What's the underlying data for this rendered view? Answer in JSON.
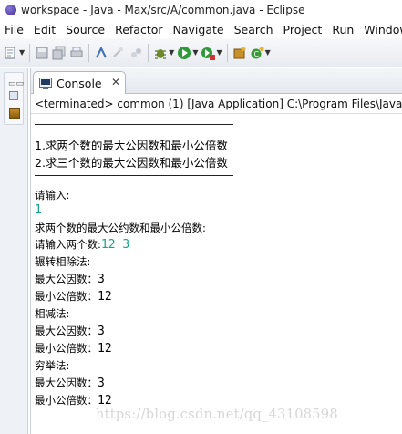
{
  "window": {
    "title": "workspace - Java - Max/src/A/common.java - Eclipse"
  },
  "menu": [
    "File",
    "Edit",
    "Source",
    "Refactor",
    "Navigate",
    "Search",
    "Project",
    "Run",
    "Window"
  ],
  "console": {
    "tab_label": "Console",
    "status": "<terminated> common (1) [Java Application] C:\\Program Files\\Java\\jre",
    "menu_options": [
      "1.求两个数的最大公因数和最小公倍数",
      "2.求三个数的最大公因数和最小公倍数"
    ],
    "prompt_input": "请输入:",
    "input_choice": "1",
    "section_heading": "求两个数的最大公约数和最小公倍数:",
    "prompt_two_numbers": "请输入两个数:",
    "input_numbers": "12 3",
    "method1": "辗转相除法:",
    "method1_gcd_label": "最大公因数：",
    "method1_gcd_value": "3",
    "method1_lcm_label": "最小公倍数：",
    "method1_lcm_value": "12",
    "method2": "相减法:",
    "method2_gcd_label": "最大公因数：",
    "method2_gcd_value": "3",
    "method2_lcm_label": "最小公倍数：",
    "method2_lcm_value": "12",
    "method3": "穷举法:",
    "method3_gcd_label": "最大公因数：",
    "method3_gcd_value": "3",
    "method3_lcm_label": "最小公倍数：",
    "method3_lcm_value": "12"
  },
  "watermark": "https://blog.csdn.net/qq_43108598",
  "icons": [
    "new-icon",
    "save-icon",
    "save-all-icon",
    "print-icon",
    "open-type-icon",
    "search-icon",
    "toggle-mark-icon",
    "debug-icon",
    "run-icon",
    "external-tools-icon",
    "new-java-package-icon",
    "new-java-class-icon",
    "minimize-icon",
    "restore-icon",
    "package-explorer-icon",
    "console-icon",
    "close-icon"
  ],
  "colors": {
    "console_input": "#13a58a",
    "toolbar_bg": "#eef1f6"
  }
}
